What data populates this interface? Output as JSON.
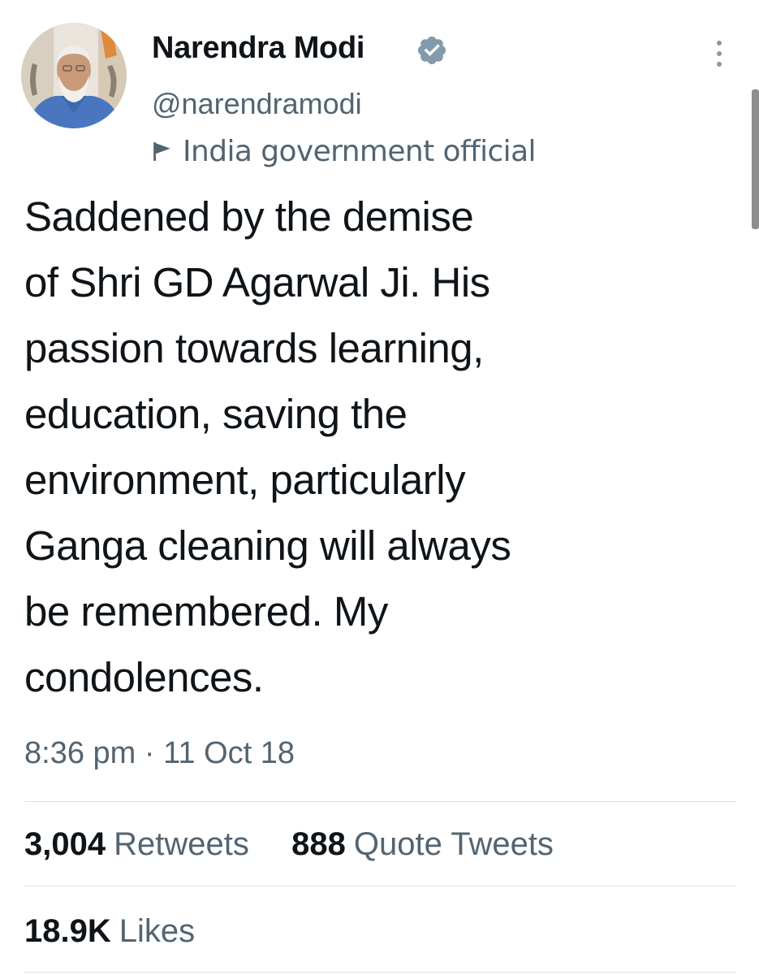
{
  "user": {
    "display_name": "Narendra Modi",
    "handle": "@narendramodi",
    "label": "India government official",
    "verified_color": "#829aab"
  },
  "tweet": {
    "text": "Saddened by the demise\nof Shri GD Agarwal Ji. His\npassion towards learning,\neducation, saving the\nenvironment, particularly\nGanga cleaning will always\nbe remembered. My\ncondolences.",
    "timestamp": "8:36 pm · 11 Oct 18"
  },
  "stats": {
    "retweets_count": "3,004",
    "retweets_label": "Retweets",
    "quotes_count": "888",
    "quotes_label": "Quote Tweets",
    "likes_count": "18.9K",
    "likes_label": "Likes"
  },
  "icons": {
    "verified": "verified-badge-icon",
    "label": "flag-icon",
    "more": "more-options-icon"
  },
  "colors": {
    "text_primary": "#0f1419",
    "text_secondary": "#536471",
    "divider": "#dfe3e6"
  }
}
